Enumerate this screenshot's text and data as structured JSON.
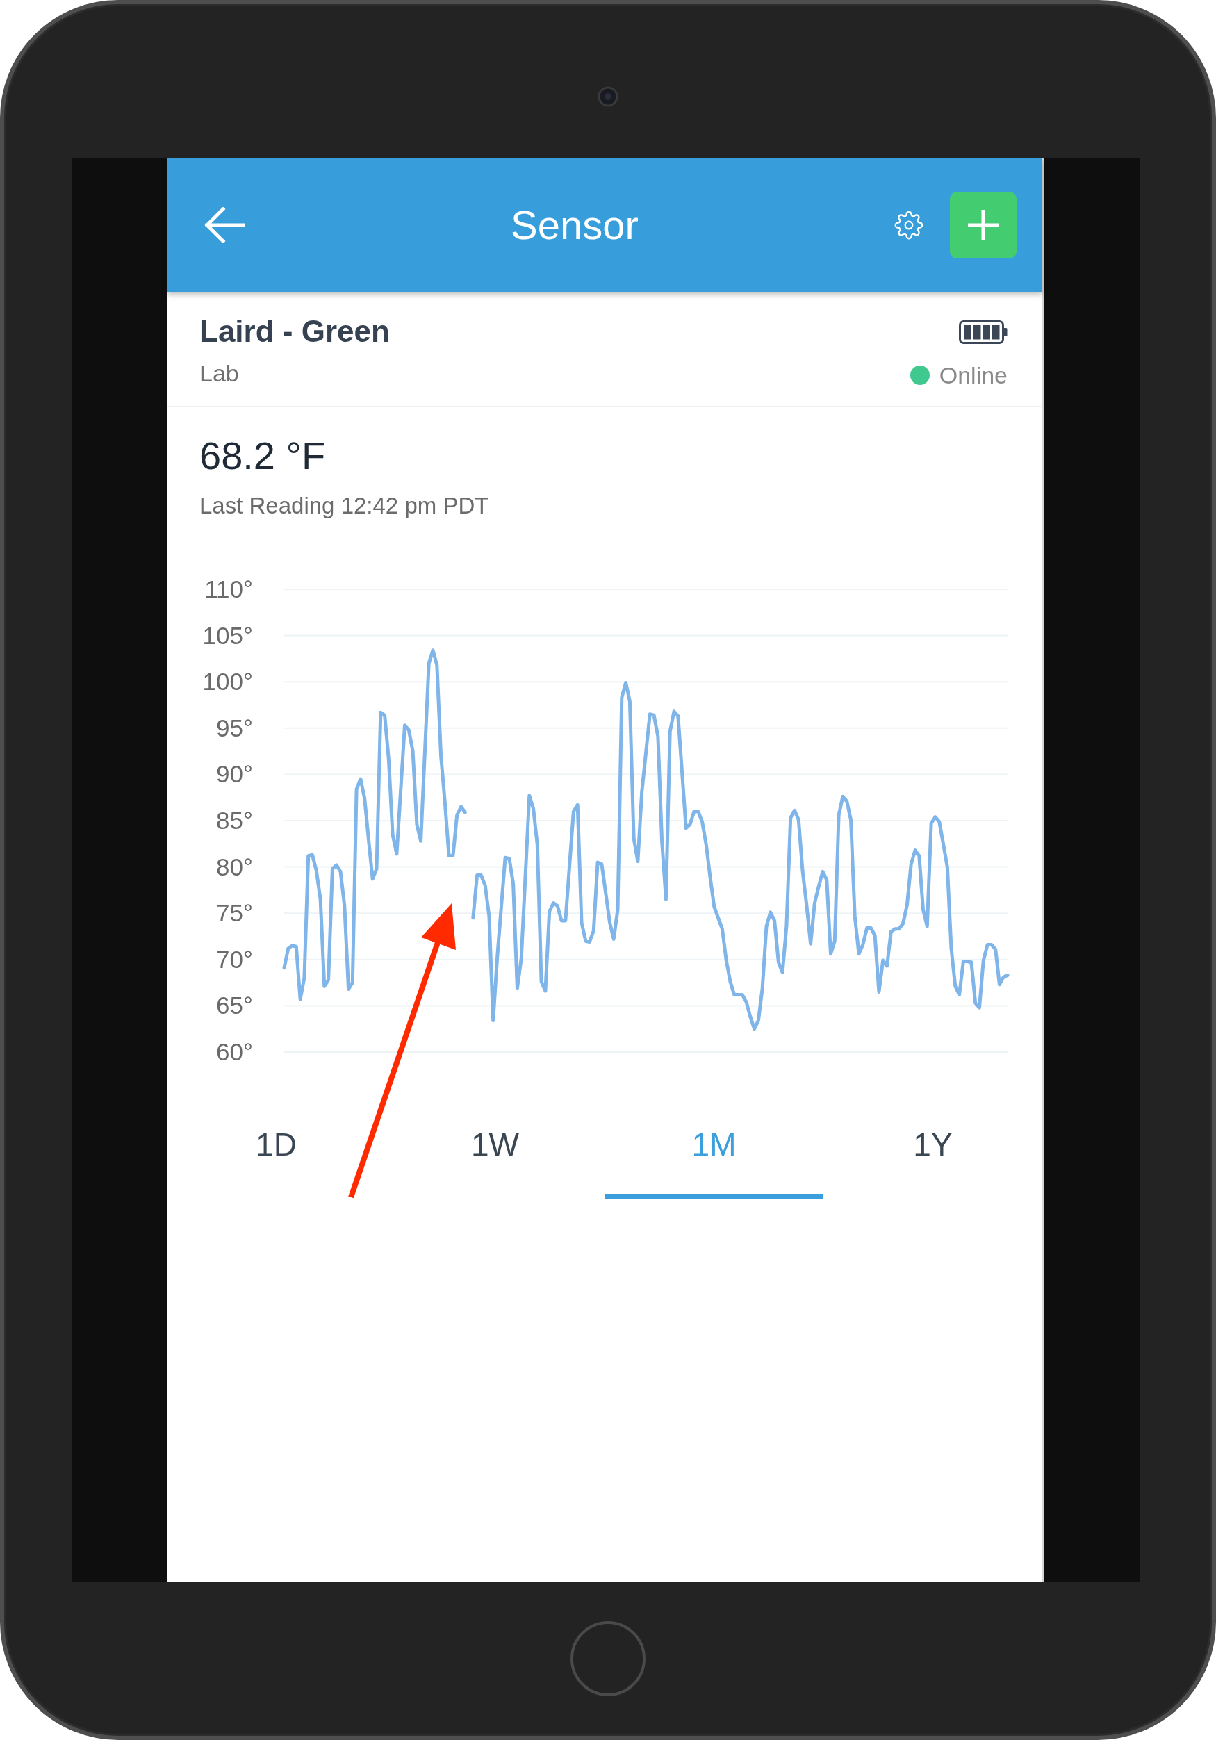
{
  "header": {
    "title": "Sensor"
  },
  "device": {
    "name": "Laird - Green",
    "location": "Lab",
    "status": {
      "label": "Online",
      "online": true
    }
  },
  "reading": {
    "value": "68.2 °F",
    "last_reading": "Last Reading 12:42 pm PDT"
  },
  "chart": {
    "chart_data": {
      "type": "line",
      "categories": [
        null,
        null,
        null,
        null,
        null,
        null,
        null,
        null,
        null,
        null,
        null,
        null,
        null,
        null,
        null,
        null,
        null,
        null,
        null,
        null,
        null,
        null,
        null,
        null,
        null,
        null,
        null,
        null,
        null,
        null,
        null,
        null,
        null,
        null,
        null,
        null,
        null,
        null,
        null,
        null,
        null,
        null,
        null,
        null,
        null,
        null,
        null,
        null,
        null,
        null,
        null,
        null,
        null,
        null,
        null,
        null,
        null,
        null,
        null,
        null,
        null,
        null,
        null,
        null,
        null,
        null,
        null,
        null,
        null,
        null,
        null,
        null,
        null,
        null,
        null,
        null,
        null,
        null,
        null,
        null,
        null,
        null,
        null,
        null,
        null,
        null,
        null,
        null,
        null,
        null,
        null,
        null,
        null,
        null,
        null,
        null,
        null,
        null,
        null,
        null,
        null,
        null,
        null,
        null,
        null,
        null,
        null,
        null,
        null,
        null,
        null,
        null,
        null,
        null,
        null,
        null,
        null,
        null,
        null,
        null,
        null,
        null,
        null,
        null,
        null,
        null,
        null,
        null,
        null,
        null,
        null,
        null,
        null,
        null,
        null,
        null,
        null,
        null,
        null,
        null,
        null,
        null,
        null,
        null,
        null,
        null,
        null,
        null,
        null,
        null,
        null,
        null,
        null,
        null,
        null,
        null,
        null,
        null,
        null,
        null,
        null,
        null,
        null,
        null,
        null,
        null,
        null,
        null,
        null,
        null,
        null,
        null,
        null,
        null,
        null,
        null,
        null,
        null,
        null,
        null,
        null
      ],
      "series": [
        {
          "color": "#7fb5e9",
          "values": [
            69.1,
            71.2,
            71.5,
            71.4,
            65.7,
            68.0,
            81.2,
            81.3,
            79.6,
            76.5,
            67.1,
            67.8,
            79.8,
            80.2,
            79.5,
            75.8,
            66.8,
            67.5,
            88.4,
            89.5,
            87.4,
            83.0,
            78.7,
            79.8,
            96.7,
            96.4,
            91.6,
            83.5,
            81.4,
            88.3,
            95.3,
            94.8,
            92.5,
            84.6,
            82.8,
            92.4,
            102.0,
            103.4,
            101.8,
            92.0,
            87.0,
            81.2,
            81.2,
            85.6,
            86.5,
            85.9,
            null,
            null,
            null,
            null,
            null,
            null,
            null,
            null,
            null,
            null,
            null,
            null,
            null,
            null,
            null,
            null,
            null,
            null,
            null,
            null,
            null,
            null,
            null,
            null,
            null,
            null,
            null,
            null,
            null,
            null,
            null,
            null,
            null,
            null,
            null,
            null,
            null,
            null,
            null,
            null,
            null,
            null,
            null,
            null,
            null,
            null,
            null,
            null,
            null,
            null,
            null,
            null,
            null,
            null,
            null,
            null,
            null,
            null,
            null,
            null,
            null,
            null,
            null,
            null,
            null,
            null,
            null,
            null,
            null,
            null,
            null,
            null,
            null,
            null,
            null,
            null,
            null,
            null,
            null,
            null,
            null,
            null,
            null,
            null,
            null,
            null,
            null,
            null,
            null,
            null,
            null,
            null,
            null,
            null,
            null,
            null,
            null,
            null,
            null,
            null,
            null,
            null,
            null,
            null,
            null,
            null,
            null,
            null,
            null,
            null,
            null,
            null,
            null,
            null,
            null,
            null,
            null,
            null,
            null,
            null,
            null,
            null,
            null,
            null,
            null,
            null,
            null,
            null,
            null,
            null,
            null,
            null,
            null,
            null,
            null
          ]
        },
        {
          "color": "#7fb5e9",
          "values": [
            null,
            null,
            null,
            null,
            null,
            null,
            null,
            null,
            null,
            null,
            null,
            null,
            null,
            null,
            null,
            null,
            null,
            null,
            null,
            null,
            null,
            null,
            null,
            null,
            null,
            null,
            null,
            null,
            null,
            null,
            null,
            null,
            null,
            null,
            null,
            null,
            null,
            null,
            null,
            null,
            null,
            null,
            null,
            null,
            null,
            null,
            null,
            74.5,
            79.1,
            79.1,
            78.0,
            74.7,
            63.4,
            70.1,
            75.6,
            81.0,
            80.9,
            78.2,
            66.9,
            70.1,
            78.9,
            87.7,
            86.3,
            82.4,
            67.6,
            66.6,
            75.2,
            76.1,
            75.8,
            74.2,
            74.2,
            80.1,
            86.0,
            86.7,
            74.0,
            72.0,
            71.9,
            73.1,
            80.5,
            80.3,
            77.2,
            74.0,
            72.2,
            75.4,
            98.3,
            99.9,
            97.9,
            83.1,
            80.6,
            88.1,
            92.3,
            96.5,
            96.4,
            94.1,
            82.8,
            76.5,
            94.6,
            96.8,
            96.3,
            90.2,
            84.2,
            84.6,
            86.0,
            86.0,
            84.9,
            82.4,
            78.9,
            75.7,
            74.5,
            73.3,
            69.9,
            67.6,
            66.2,
            66.2,
            66.2,
            65.4,
            63.8,
            62.5,
            63.4,
            66.9,
            73.6,
            75.1,
            74.2,
            69.7,
            68.6,
            73.6,
            85.3,
            86.1,
            85.1,
            79.6,
            75.9,
            71.7,
            76.1,
            77.9,
            79.5,
            78.6,
            70.6,
            72.0,
            85.6,
            87.6,
            87.1,
            85.1,
            74.7,
            70.6,
            71.6,
            73.4,
            73.4,
            72.6,
            66.5,
            69.9,
            69.3,
            73.0,
            73.3,
            73.3,
            73.9,
            75.9,
            80.3,
            81.8,
            81.2,
            75.4,
            73.6,
            84.7,
            85.4,
            84.9,
            82.5,
            80.0,
            71.2,
            67.1,
            66.2,
            69.8,
            69.8,
            69.7,
            65.3,
            64.8,
            69.9,
            71.6,
            71.6,
            71.1,
            67.3,
            68.1,
            68.3
          ]
        }
      ],
      "ylim": [
        60,
        110
      ],
      "yticks": [
        {
          "value": 60,
          "label": "60°"
        },
        {
          "value": 65,
          "label": "65°"
        },
        {
          "value": 70,
          "label": "70°"
        },
        {
          "value": 75,
          "label": "75°"
        },
        {
          "value": 80,
          "label": "80°"
        },
        {
          "value": 85,
          "label": "85°"
        },
        {
          "value": 90,
          "label": "90°"
        },
        {
          "value": 95,
          "label": "95°"
        },
        {
          "value": 100,
          "label": "100°"
        },
        {
          "value": 105,
          "label": "105°"
        },
        {
          "value": 110,
          "label": "110°"
        }
      ],
      "grid": true
    }
  },
  "tabs": [
    {
      "label": "1D",
      "selected": false
    },
    {
      "label": "1W",
      "selected": false
    },
    {
      "label": "1M",
      "selected": true
    },
    {
      "label": "1Y",
      "selected": false
    }
  ]
}
